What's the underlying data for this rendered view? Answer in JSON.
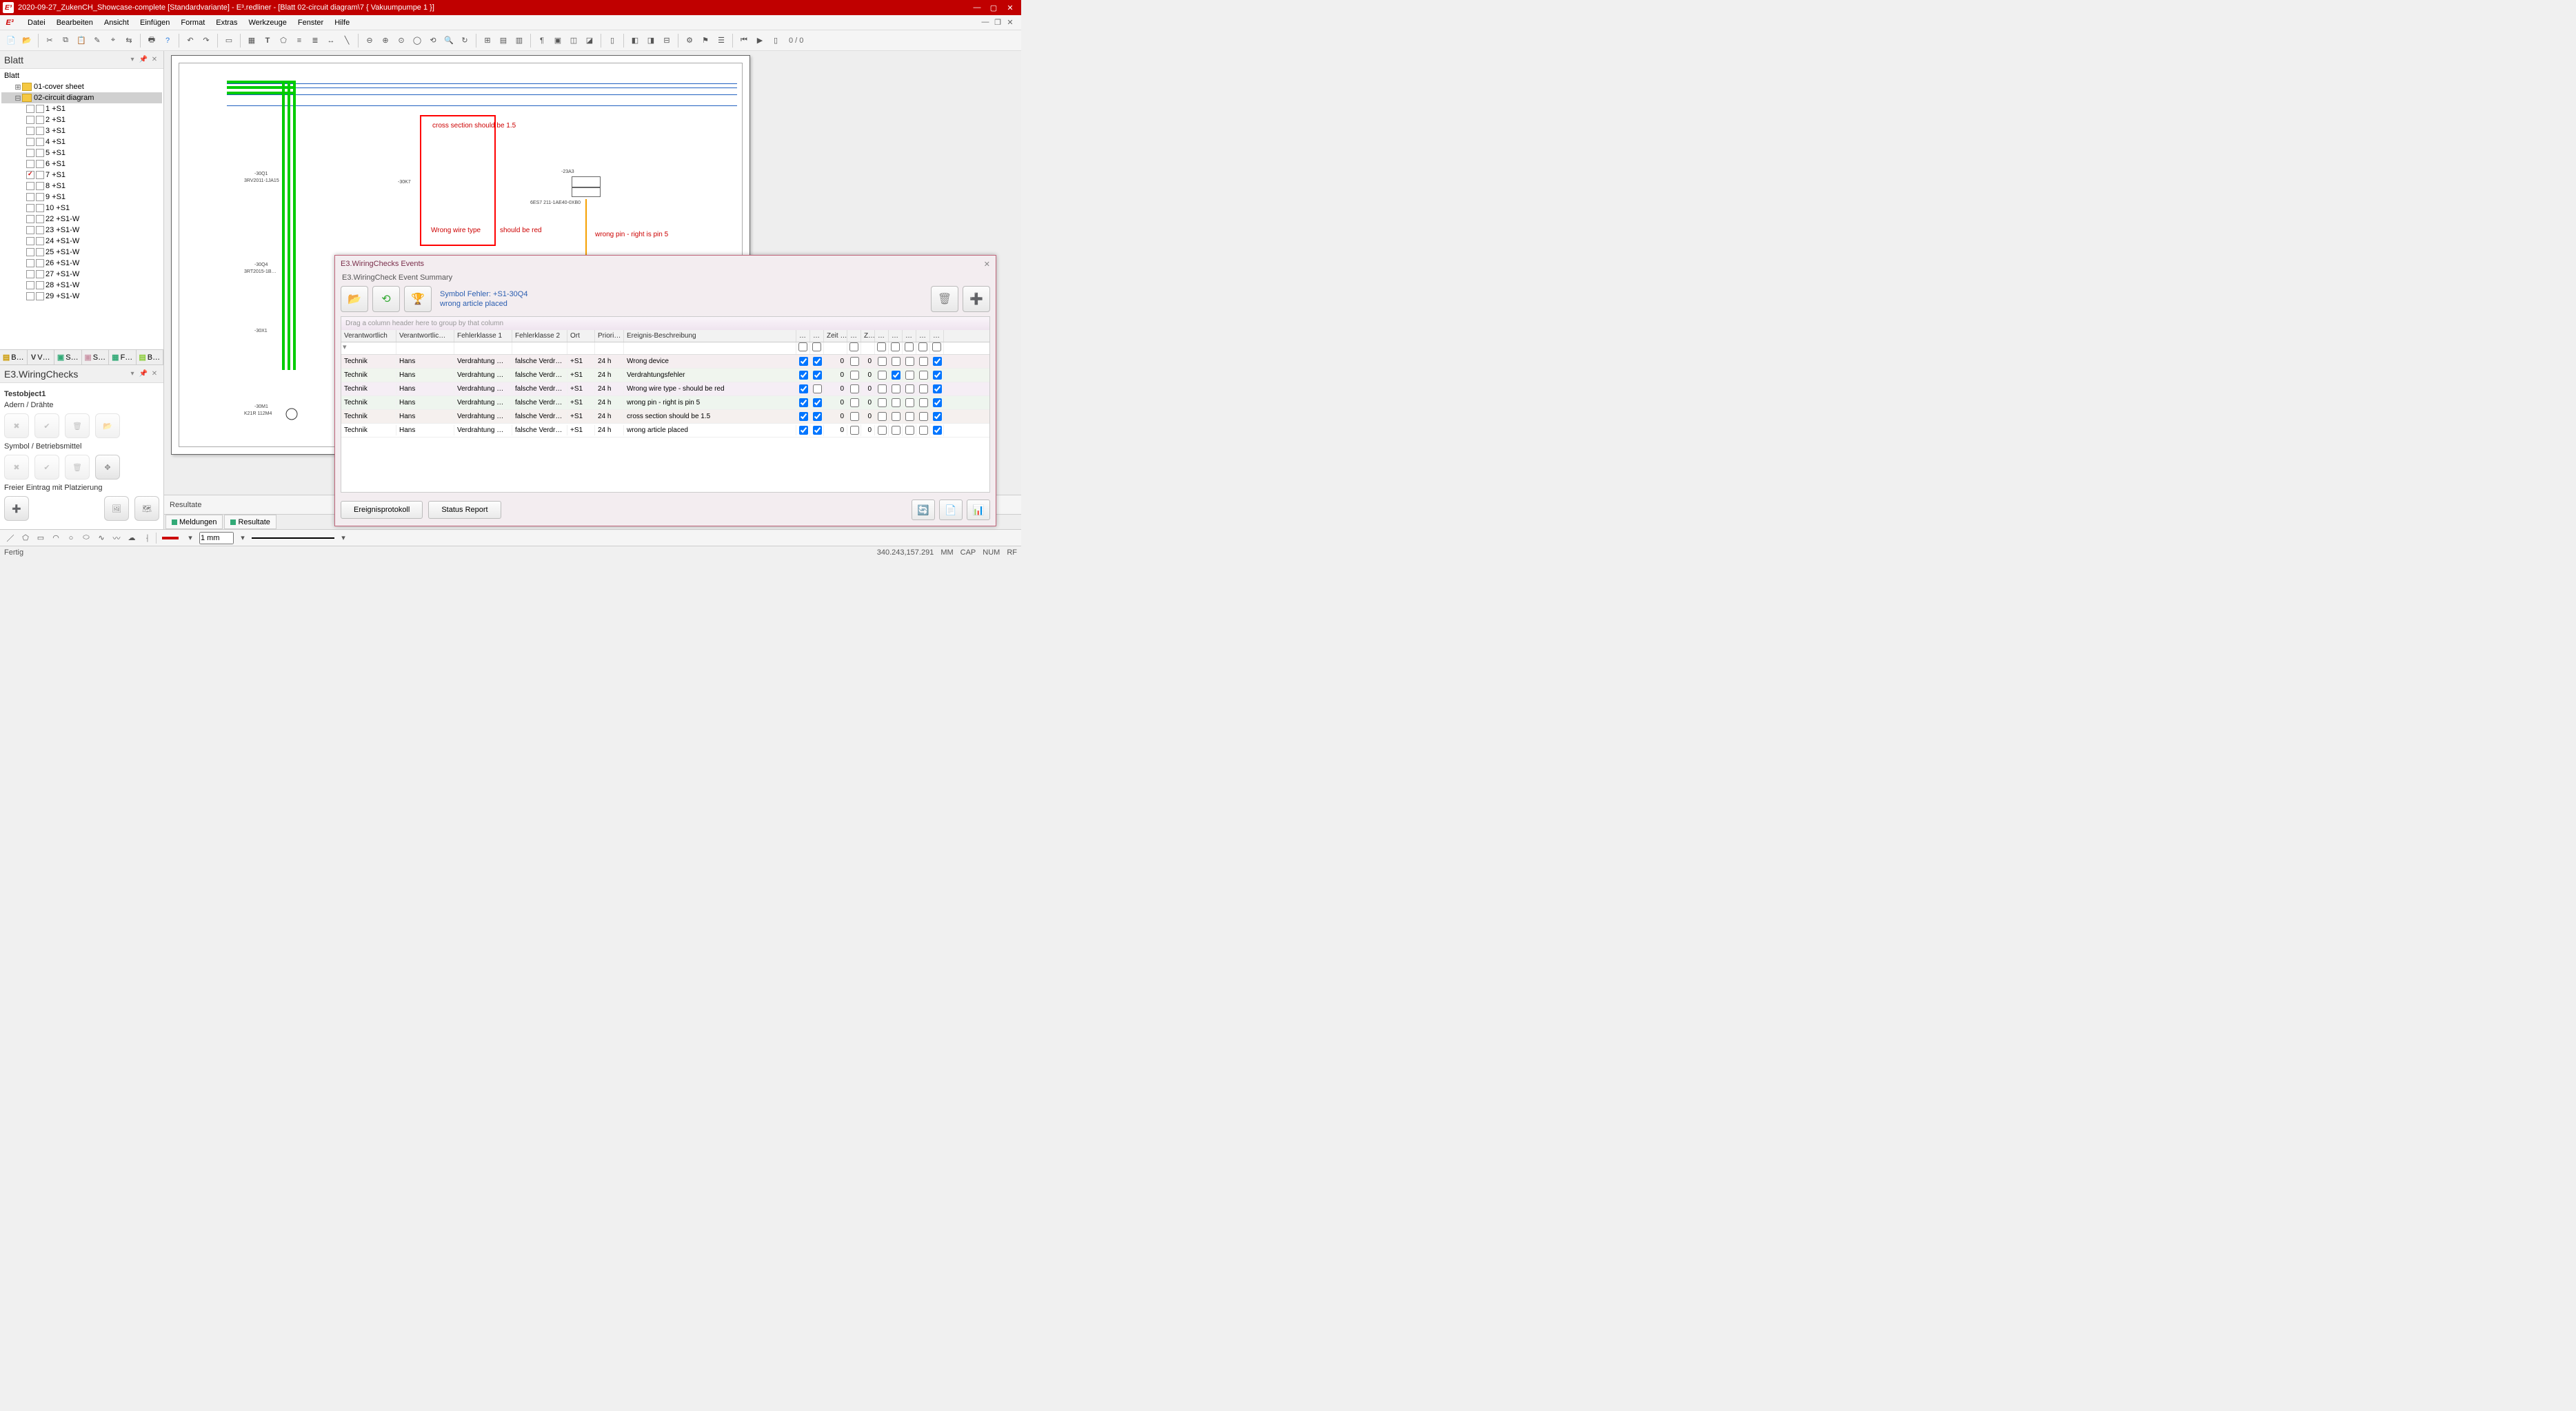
{
  "titlebar": {
    "app_icon": "E³",
    "title": "2020-09-27_ZukenCH_Showcase-complete [Standardvariante] - E³.redliner - [Blatt 02-circuit diagram\\7 { Vakuumpumpe 1 }]"
  },
  "menu": [
    "Datei",
    "Bearbeiten",
    "Ansicht",
    "Einfügen",
    "Format",
    "Extras",
    "Werkzeuge",
    "Fenster",
    "Hilfe"
  ],
  "toolbar_counter": "0 / 0",
  "blatt": {
    "title": "Blatt",
    "root": "Blatt",
    "folders": [
      {
        "name": "01-cover sheet",
        "open": false
      },
      {
        "name": "02-circuit diagram",
        "open": true,
        "selected": true,
        "sheets": [
          {
            "n": "1 +S1"
          },
          {
            "n": "2 +S1"
          },
          {
            "n": "3 +S1"
          },
          {
            "n": "4 +S1"
          },
          {
            "n": "5 +S1",
            "mark": true
          },
          {
            "n": "6 +S1"
          },
          {
            "n": "7 +S1",
            "chk": true
          },
          {
            "n": "8 +S1"
          },
          {
            "n": "9 +S1"
          },
          {
            "n": "10 +S1"
          },
          {
            "n": "22 +S1-W"
          },
          {
            "n": "23 +S1-W"
          },
          {
            "n": "24 +S1-W"
          },
          {
            "n": "25 +S1-W"
          },
          {
            "n": "26 +S1-W"
          },
          {
            "n": "27 +S1-W"
          },
          {
            "n": "28 +S1-W"
          },
          {
            "n": "29 +S1-W"
          }
        ]
      }
    ],
    "tabs": [
      "B…",
      "V…",
      "S…",
      "S…",
      "F…",
      "B…"
    ]
  },
  "wiring": {
    "title": "E3.WiringChecks",
    "obj": "Testobject1",
    "sub": "Adern / Drähte",
    "section2": "Symbol / Betriebsmittel",
    "section3": "Freier Eintrag mit Platzierung"
  },
  "canvas": {
    "annotations": {
      "a1": "cross section should be 1.5",
      "a2": "Wrong wire type",
      "a3": "should be red",
      "a4": "wrong pin - right is pin 5"
    },
    "labels": {
      "q1": "-30Q1",
      "q1s": "3RV2011-1JA15",
      "q4": "-30Q4",
      "q4s": "3RT2015-1B…",
      "k7": "-30K7",
      "a3": "-23A3",
      "a3s": "6ES7 211-1AE40-0XB0",
      "x1": "-30X1",
      "m1": "-30M1",
      "m1s": "K21R 112M4"
    }
  },
  "results": {
    "title": "Resultate",
    "tabs": [
      "Meldungen",
      "Resultate"
    ]
  },
  "drawbar": {
    "width": "1 mm"
  },
  "status": {
    "left": "Fertig",
    "coord": "340.243,157.291",
    "unit": "MM",
    "caps": "CAP",
    "num": "NUM",
    "rf": "RF"
  },
  "events": {
    "title": "E3.WiringChecks Events",
    "subtitle": "E3.WiringCheck Event Summary",
    "symbol_line1": "Symbol Fehler: +S1-30Q4",
    "symbol_line2": "wrong article placed",
    "group_hint": "Drag a column header here to group by that column",
    "columns": [
      "Verantwortlich",
      "Verantwortlic…",
      "Fehlerklasse 1",
      "Fehlerklasse 2",
      "Ort",
      "Priori…",
      "Ereignis-Beschreibung",
      "…",
      "…",
      "Zeit …",
      "…",
      "Z…",
      "…",
      "…",
      "…",
      "…",
      "…"
    ],
    "rows": [
      {
        "dept": "Technik",
        "who": "Hans",
        "f1": "Verdrahtung …",
        "f2": "falsche Verdr…",
        "ort": "+S1",
        "prio": "24 h",
        "desc": "Wrong device",
        "c1": true,
        "c2": true,
        "v1": 0,
        "v2": 0,
        "cks": [
          false,
          false,
          false,
          false,
          true
        ]
      },
      {
        "dept": "Technik",
        "who": "Hans",
        "f1": "Verdrahtung …",
        "f2": "falsche Verdr…",
        "ort": "+S1",
        "prio": "24 h",
        "desc": "Verdrahtungsfehler",
        "c1": true,
        "c2": true,
        "v1": 0,
        "v2": 0,
        "cks": [
          false,
          true,
          false,
          false,
          true
        ]
      },
      {
        "dept": "Technik",
        "who": "Hans",
        "f1": "Verdrahtung …",
        "f2": "falsche Verdr…",
        "ort": "+S1",
        "prio": "24 h",
        "desc": "Wrong wire type - should be red",
        "c1": true,
        "c2": false,
        "v1": 0,
        "v2": 0,
        "cks": [
          false,
          false,
          false,
          false,
          true
        ]
      },
      {
        "dept": "Technik",
        "who": "Hans",
        "f1": "Verdrahtung …",
        "f2": "falsche Verdr…",
        "ort": "+S1",
        "prio": "24 h",
        "desc": "wrong pin - right is pin 5",
        "c1": true,
        "c2": true,
        "v1": 0,
        "v2": 0,
        "cks": [
          false,
          false,
          false,
          false,
          true
        ]
      },
      {
        "dept": "Technik",
        "who": "Hans",
        "f1": "Verdrahtung …",
        "f2": "falsche Verdr…",
        "ort": "+S1",
        "prio": "24 h",
        "desc": "cross section should be 1.5",
        "c1": true,
        "c2": true,
        "v1": 0,
        "v2": 0,
        "cks": [
          false,
          false,
          false,
          false,
          true
        ]
      },
      {
        "dept": "Technik",
        "who": "Hans",
        "f1": "Verdrahtung …",
        "f2": "falsche Verdr…",
        "ort": "+S1",
        "prio": "24 h",
        "desc": "wrong article placed",
        "c1": true,
        "c2": true,
        "v1": 0,
        "v2": 0,
        "cks": [
          false,
          false,
          false,
          false,
          true
        ]
      }
    ],
    "buttons": {
      "proto": "Ereignisprotokoll",
      "report": "Status Report"
    }
  }
}
